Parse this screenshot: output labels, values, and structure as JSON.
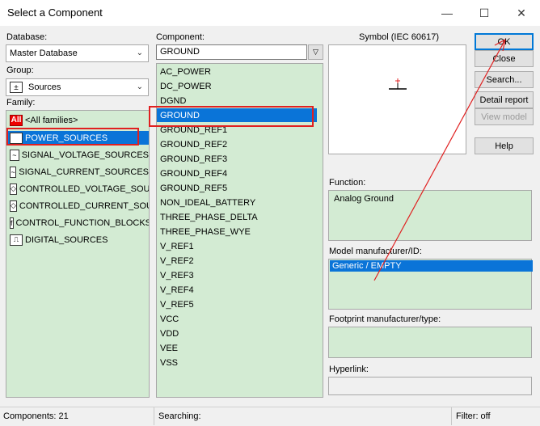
{
  "window": {
    "title": "Select a Component",
    "controls": [
      "—",
      "☐",
      "✕"
    ]
  },
  "database": {
    "label": "Database:",
    "value": "Master Database"
  },
  "group": {
    "label": "Group:",
    "value": "Sources"
  },
  "family": {
    "label": "Family:",
    "items": [
      {
        "icon": "All",
        "label": "<All families>"
      },
      {
        "icon": "PWR",
        "label": "POWER_SOURCES",
        "selected": true
      },
      {
        "icon": "~",
        "label": "SIGNAL_VOLTAGE_SOURCES"
      },
      {
        "icon": "~",
        "label": "SIGNAL_CURRENT_SOURCES"
      },
      {
        "icon": "◇",
        "label": "CONTROLLED_VOLTAGE_SOUR"
      },
      {
        "icon": "◇",
        "label": "CONTROLLED_CURRENT_SOUI"
      },
      {
        "icon": "f",
        "label": "CONTROL_FUNCTION_BLOCKS"
      },
      {
        "icon": "⎍",
        "label": "DIGITAL_SOURCES"
      }
    ]
  },
  "component": {
    "label": "Component:",
    "value": "GROUND",
    "items": [
      "AC_POWER",
      "DC_POWER",
      "DGND",
      "GROUND",
      "GROUND_REF1",
      "GROUND_REF2",
      "GROUND_REF3",
      "GROUND_REF4",
      "GROUND_REF5",
      "NON_IDEAL_BATTERY",
      "THREE_PHASE_DELTA",
      "THREE_PHASE_WYE",
      "V_REF1",
      "V_REF2",
      "V_REF3",
      "V_REF4",
      "V_REF5",
      "VCC",
      "VDD",
      "VEE",
      "VSS"
    ],
    "selected_index": 3
  },
  "symbol": {
    "label": "Symbol (IEC 60617)"
  },
  "function": {
    "label": "Function:",
    "value": "Analog Ground"
  },
  "model": {
    "label": "Model manufacturer/ID:",
    "value": "Generic / EMPTY"
  },
  "footprint": {
    "label": "Footprint manufacturer/type:"
  },
  "hyperlink": {
    "label": "Hyperlink:"
  },
  "buttons": {
    "ok": "OK",
    "close": "Close",
    "search": "Search...",
    "detail": "Detail report",
    "view_model": "View model",
    "help": "Help"
  },
  "status": {
    "components": "Components: 21",
    "searching": "Searching:",
    "filter": "Filter: off"
  },
  "colors": {
    "list_bg": "#d3ebd3",
    "selection": "#0a74d8",
    "highlight_box": "#e02020",
    "arrow": "#e02020"
  }
}
